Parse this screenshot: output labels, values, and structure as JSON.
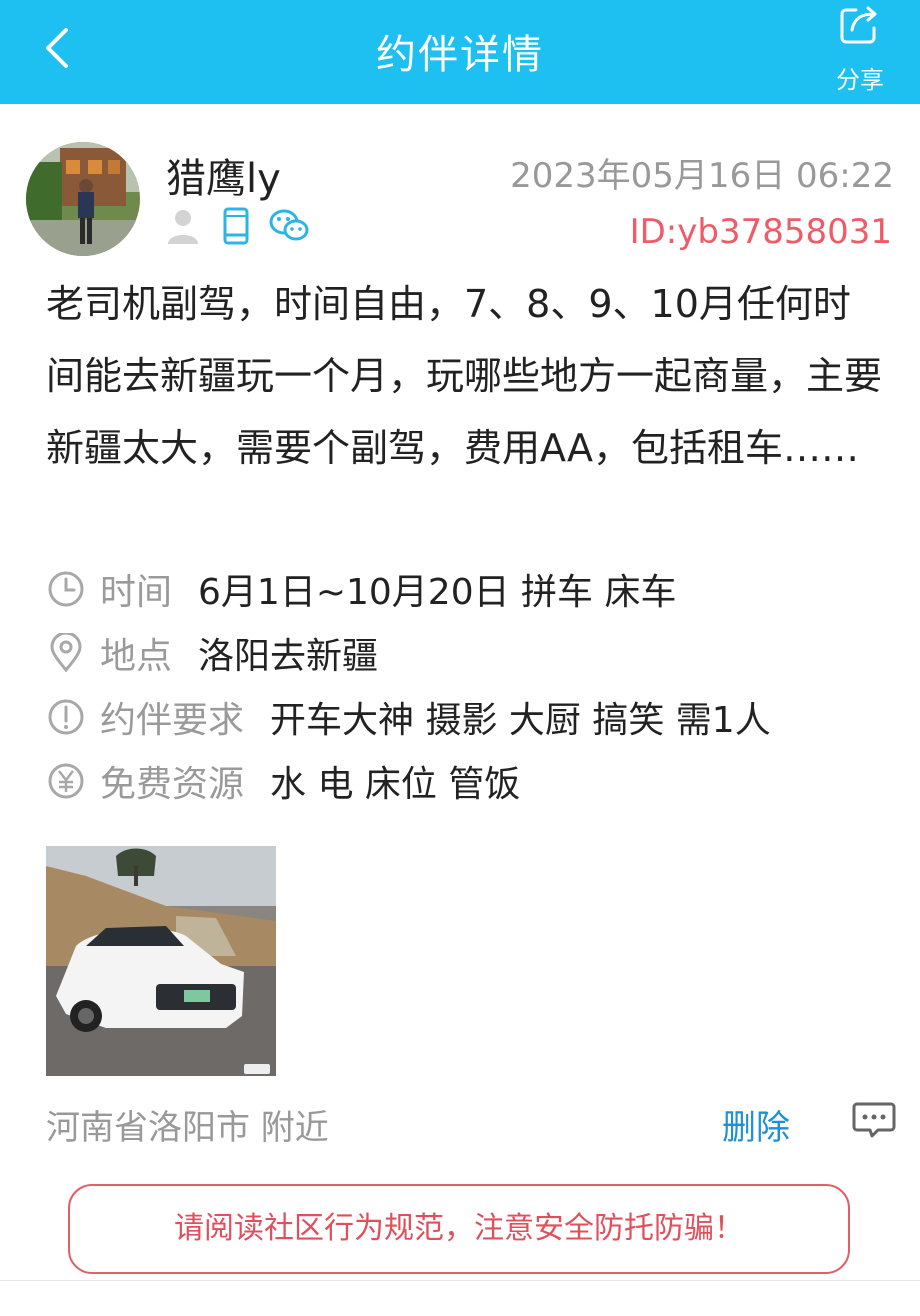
{
  "header": {
    "title": "约伴详情",
    "share_label": "分享"
  },
  "post": {
    "username": "猎鹰ly",
    "time": "2023年05月16日 06:22",
    "user_id": "ID:yb37858031",
    "description": "老司机副驾，时间自由，7、8、9、10月任何时间能去新疆玩一个月，玩哪些地方一起商量，主要新疆太大，需要个副驾，费用AA，包括租车……",
    "info": [
      {
        "label": "时间",
        "value": "6月1日~10月20日 拼车 床车",
        "icon": "clock-icon"
      },
      {
        "label": "地点",
        "value": "洛阳去新疆",
        "icon": "location-pin-icon"
      },
      {
        "label": "约伴要求",
        "value": "开车大神 摄影 大厨 搞笑  需1人",
        "icon": "exclamation-circle-icon"
      },
      {
        "label": "免费资源",
        "value": "水 电 床位 管饭",
        "icon": "yuan-circle-icon"
      }
    ],
    "location": "河南省洛阳市  附近",
    "delete_label": "删除"
  },
  "notice": "请阅读社区行为规范，注意安全防托防骗！",
  "colors": {
    "header_bg": "#1dc0f0",
    "id_red": "#ee5c68",
    "link_blue": "#1e8fd8",
    "notice_red": "#e0505c"
  }
}
